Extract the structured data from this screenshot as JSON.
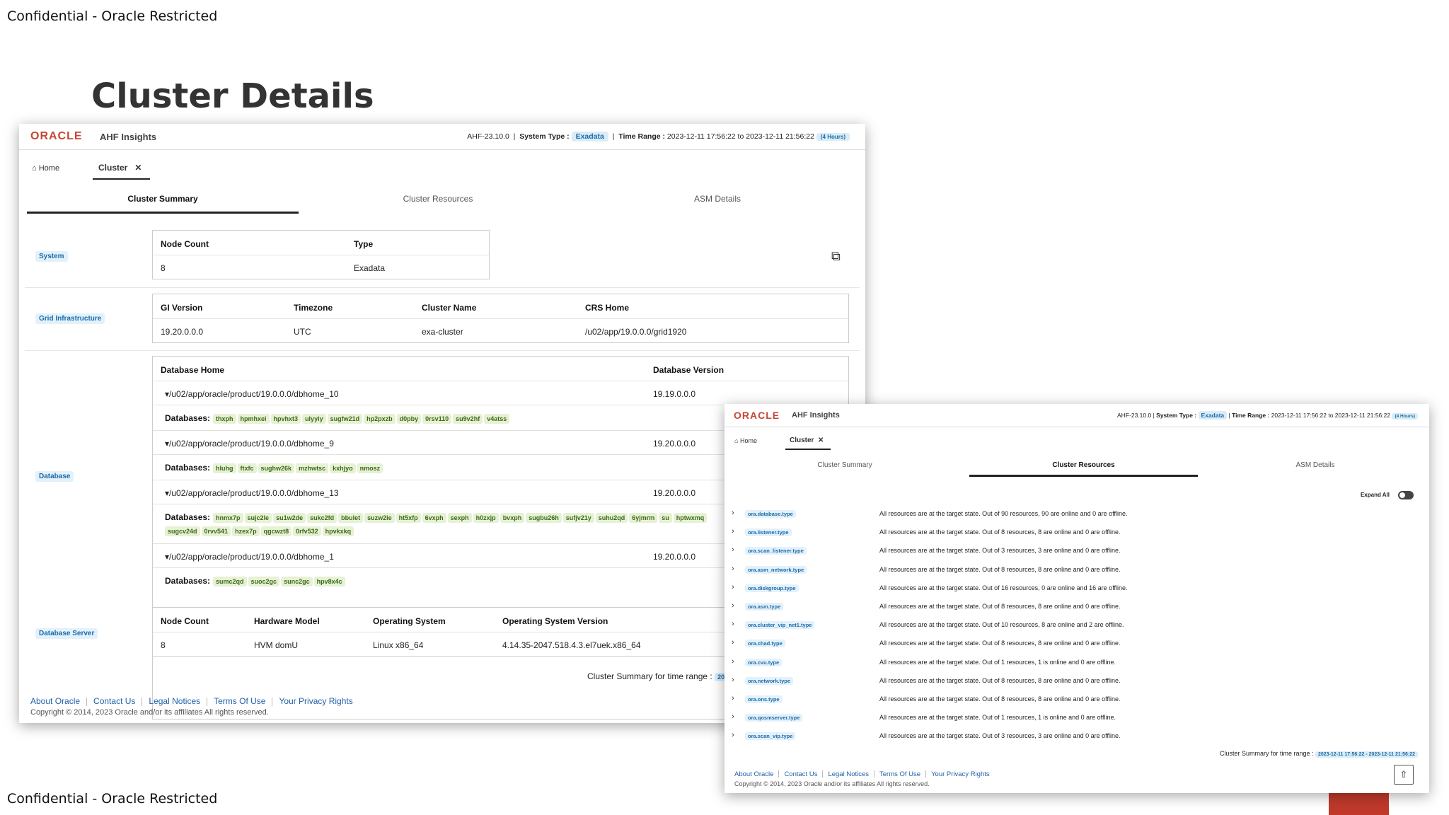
{
  "slide": {
    "confidential_top": "Confidential - Oracle Restricted",
    "confidential_bottom": "Confidential - Oracle Restricted",
    "title": "Cluster Details"
  },
  "header": {
    "logo": "ORACLE",
    "product": "AHF Insights",
    "version": "AHF-23.10.0",
    "system_type_label": "System Type :",
    "system_type": "Exadata",
    "time_range_label": "Time Range :",
    "time_range": "2023-12-11 17:56:22 to 2023-12-11 21:56:22",
    "duration": "(4 Hours)"
  },
  "nav": {
    "home": "Home",
    "cluster": "Cluster"
  },
  "subtabs": [
    "Cluster Summary",
    "Cluster Resources",
    "ASM Details"
  ],
  "sections": {
    "system": "System",
    "grid": "Grid Infrastructure",
    "database": "Database",
    "db_server": "Database Server"
  },
  "system_table": {
    "headers": [
      "Node Count",
      "Type"
    ],
    "row": [
      "8",
      "Exadata"
    ]
  },
  "grid_table": {
    "headers": [
      "GI Version",
      "Timezone",
      "Cluster Name",
      "CRS Home"
    ],
    "row": [
      "19.20.0.0.0",
      "UTC",
      "exa-cluster",
      "/u02/app/19.0.0.0/grid1920"
    ]
  },
  "db_table": {
    "headers": [
      "Database Home",
      "Database Version"
    ],
    "databases_label": "Databases:",
    "homes": [
      {
        "path": "/u02/app/oracle/product/19.0.0.0/dbhome_10",
        "version": "19.19.0.0.0",
        "dbs": [
          "thxph",
          "hpmhxei",
          "hpvhxt3",
          "ulyyiy",
          "sugfw21d",
          "hp2pxzb",
          "d0pby",
          "0rsv110",
          "su9v2hf",
          "v4atss"
        ]
      },
      {
        "path": "/u02/app/oracle/product/19.0.0.0/dbhome_9",
        "version": "19.20.0.0.0",
        "dbs": [
          "hluhg",
          "ftxfc",
          "sughw26k",
          "mzhwtsc",
          "kxhjyo",
          "nmosz"
        ]
      },
      {
        "path": "/u02/app/oracle/product/19.0.0.0/dbhome_13",
        "version": "19.20.0.0.0",
        "dbs": [
          "hnmx7p",
          "sujc2le",
          "su1w2de",
          "sukc2fd",
          "bbulet",
          "suzw2ie",
          "ht5xfp",
          "6vxph",
          "sexph",
          "h0zxjp",
          "bvxph",
          "sugbu26h",
          "sufjv21y",
          "suhu2qd",
          "6yjmrm",
          "su",
          "hptwxmq",
          "sugcv24d",
          "0rvv541",
          "hzex7p",
          "qgcwzt8",
          "0rfv532",
          "hpvkxkq"
        ]
      },
      {
        "path": "/u02/app/oracle/product/19.0.0.0/dbhome_1",
        "version": "19.20.0.0.0",
        "dbs": [
          "sumc2qd",
          "suoc2gc",
          "sunc2gc",
          "hpv8x4c"
        ]
      }
    ]
  },
  "server_table": {
    "headers": [
      "Node Count",
      "Hardware Model",
      "Operating System",
      "Operating System Version"
    ],
    "row": [
      "8",
      "HVM domU",
      "Linux x86_64",
      "4.14.35-2047.518.4.3.el7uek.x86_64"
    ]
  },
  "summary_range_label": "Cluster Summary for time range :",
  "summary_range_clip": "20",
  "summary_range_value": "2023-12-11 17:56:22 - 2023-12-11 21:56:22",
  "footer": {
    "links": [
      "About Oracle",
      "Contact Us",
      "Legal Notices",
      "Terms Of Use",
      "Your Privacy Rights"
    ],
    "copyright": "Copyright © 2014, 2023 Oracle and/or its affiliates All rights reserved."
  },
  "resources": {
    "expand_all": "Expand All",
    "rows": [
      {
        "type": "ora.database.type",
        "summary": "All resources are at the target state. Out of 90 resources, 90 are online and 0 are offline."
      },
      {
        "type": "ora.listener.type",
        "summary": "All resources are at the target state. Out of 8 resources, 8 are online and 0 are offline."
      },
      {
        "type": "ora.scan_listener.type",
        "summary": "All resources are at the target state. Out of 3 resources, 3 are online and 0 are offline."
      },
      {
        "type": "ora.asm_network.type",
        "summary": "All resources are at the target state. Out of 8 resources, 8 are online and 0 are offline."
      },
      {
        "type": "ora.diskgroup.type",
        "summary": "All resources are at the target state. Out of 16 resources, 0 are online and 16 are offline."
      },
      {
        "type": "ora.asm.type",
        "summary": "All resources are at the target state. Out of 8 resources, 8 are online and 0 are offline."
      },
      {
        "type": "ora.cluster_vip_net1.type",
        "summary": "All resources are at the target state. Out of 10 resources, 8 are online and 2 are offline."
      },
      {
        "type": "ora.chad.type",
        "summary": "All resources are at the target state. Out of 8 resources, 8 are online and 0 are offline."
      },
      {
        "type": "ora.cvu.type",
        "summary": "All resources are at the target state. Out of 1 resources, 1 is online and 0 are offline."
      },
      {
        "type": "ora.network.type",
        "summary": "All resources are at the target state. Out of 8 resources, 8 are online and 0 are offline."
      },
      {
        "type": "ora.ons.type",
        "summary": "All resources are at the target state. Out of 8 resources, 8 are online and 0 are offline."
      },
      {
        "type": "ora.qosmserver.type",
        "summary": "All resources are at the target state. Out of 1 resources, 1 is online and 0 are offline."
      },
      {
        "type": "ora.scan_vip.type",
        "summary": "All resources are at the target state. Out of 3 resources, 3 are online and 0 are offline."
      }
    ]
  }
}
